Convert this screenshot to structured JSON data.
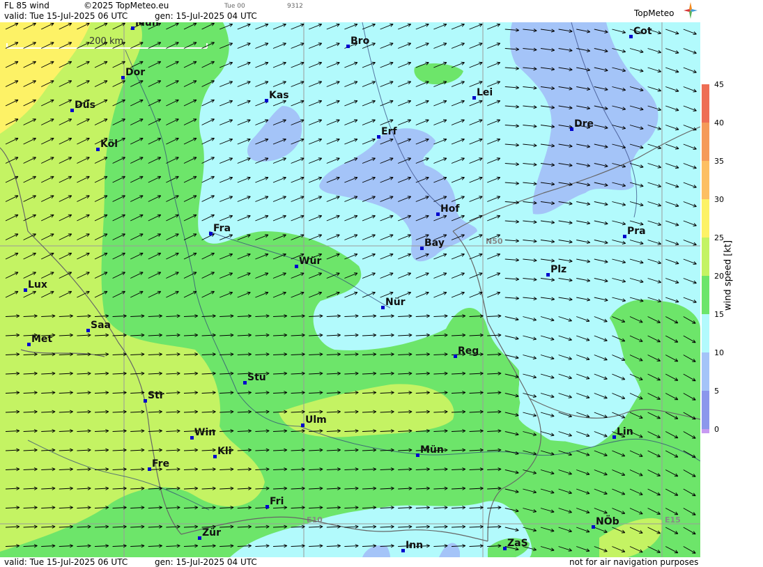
{
  "header": {
    "product": "FL 85 wind",
    "copyright": "©2025 TopMeteo.eu",
    "valid": "valid:  Tue  15-Jul-2025  06 UTC",
    "gen": "gen: 15-Jul-2025 04 UTC",
    "tue_code": "Tue 00",
    "code": "9312",
    "logo": "TopMeteo"
  },
  "footer": {
    "valid": "valid:  Tue  15-Jul-2025  06 UTC",
    "gen": "gen: 15-Jul-2025 04 UTC",
    "note": "not for air navigation purposes"
  },
  "scale_bar": {
    "label": "200 km"
  },
  "grid_labels": [
    "N50",
    "E10",
    "E15"
  ],
  "colorbar": {
    "title": "wind speed [kt]",
    "ticks": [
      "45",
      "40",
      "35",
      "30",
      "25",
      "20",
      "15",
      "10",
      "5",
      "0"
    ],
    "colors": [
      "#ee6e55",
      "#f59a59",
      "#fdbf62",
      "#fdf266",
      "#c4f363",
      "#6de56a",
      "#b2fafc",
      "#a4c4f8",
      "#8b97ec",
      "#c79af2"
    ]
  },
  "cities": [
    "Mün",
    "Bro",
    "Cot",
    "Dor",
    "Düs",
    "Kas",
    "Lei",
    "Köl",
    "Erf",
    "Dre",
    "Hof",
    "Fra",
    "Bay",
    "Pra",
    "Wür",
    "Plz",
    "Lux",
    "Nür",
    "Saa",
    "Met",
    "Reg",
    "Stu",
    "Str",
    "Ulm",
    "Win",
    "Lin",
    "Kli",
    "Mün",
    "Fre",
    "Fri",
    "NÖb",
    "Zür",
    "ZaS",
    "Inn"
  ]
}
